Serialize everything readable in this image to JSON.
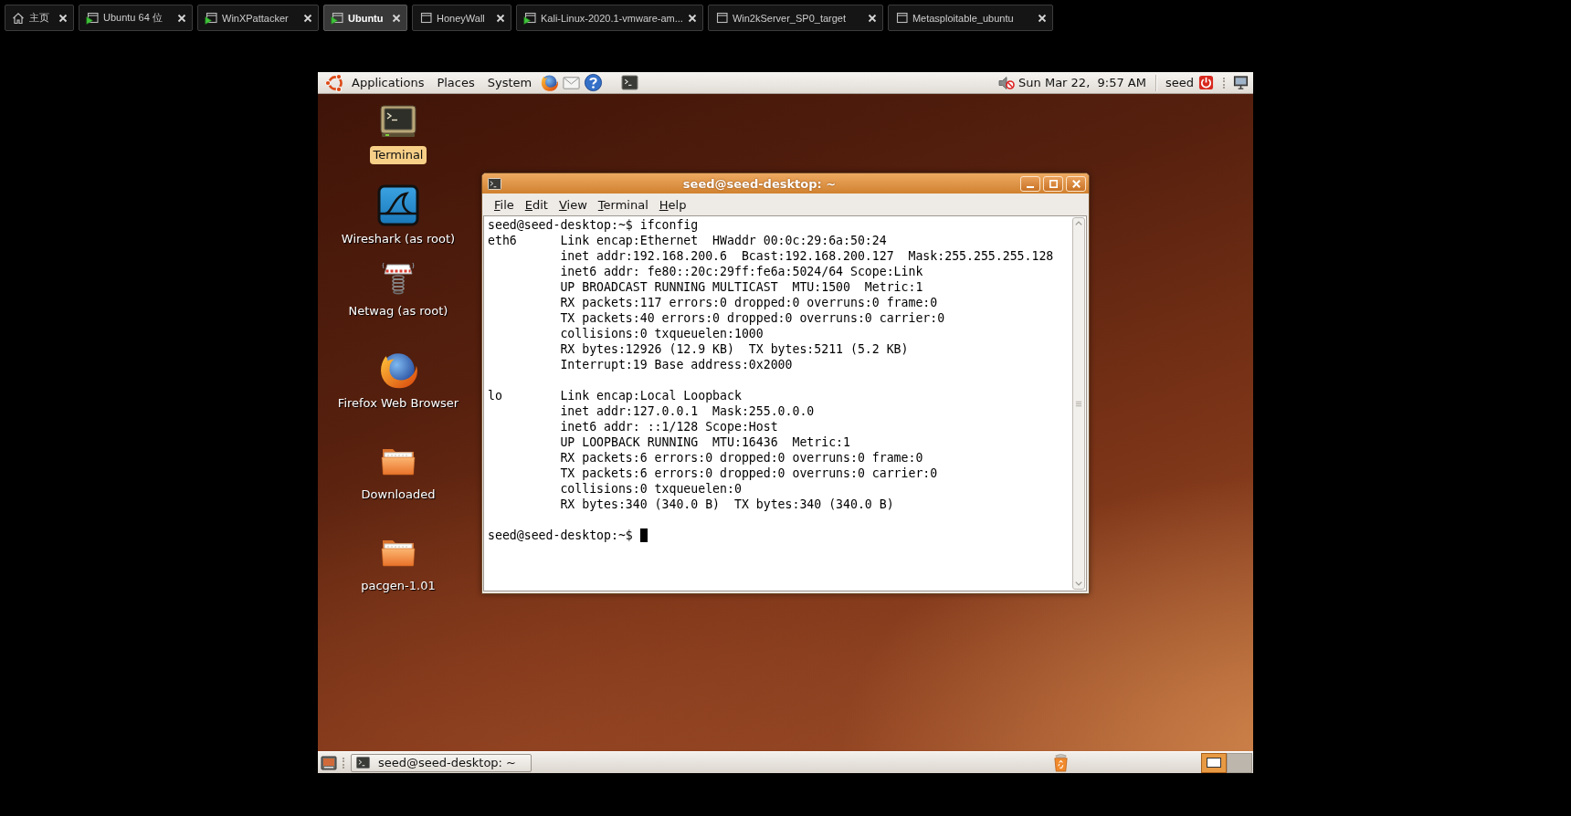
{
  "tabs": [
    {
      "label": "主页",
      "kind": "home",
      "selected": false
    },
    {
      "label": "Ubuntu 64 位",
      "kind": "vm",
      "running": true,
      "selected": false
    },
    {
      "label": "WinXPattacker",
      "kind": "vm",
      "running": true,
      "selected": false
    },
    {
      "label": "Ubuntu",
      "kind": "vm",
      "running": true,
      "selected": true
    },
    {
      "label": "HoneyWall",
      "kind": "vm",
      "running": false,
      "selected": false
    },
    {
      "label": "Kali-Linux-2020.1-vmware-am...",
      "kind": "vm",
      "running": true,
      "selected": false
    },
    {
      "label": "Win2kServer_SP0_target",
      "kind": "vm",
      "running": false,
      "selected": false
    },
    {
      "label": "Metasploitable_ubuntu",
      "kind": "vm",
      "running": false,
      "selected": false
    }
  ],
  "top_panel": {
    "menus": [
      "Applications",
      "Places",
      "System"
    ],
    "clock": "Sun Mar 22,  9:57 AM",
    "user": "seed"
  },
  "desktop_icons": [
    {
      "label": "Terminal",
      "kind": "terminal",
      "selected": true
    },
    {
      "label": "Wireshark (as root)",
      "kind": "wireshark",
      "selected": false
    },
    {
      "label": "Netwag (as root)",
      "kind": "netwag",
      "selected": false
    },
    {
      "label": "Firefox Web Browser",
      "kind": "browser",
      "selected": false
    },
    {
      "label": "Downloaded",
      "kind": "folder",
      "selected": false
    },
    {
      "label": "pacgen-1.01",
      "kind": "folder",
      "selected": false
    }
  ],
  "terminal_window": {
    "title": "seed@seed-desktop: ~",
    "menus": [
      "File",
      "Edit",
      "View",
      "Terminal",
      "Help"
    ],
    "command_line": "seed@seed-desktop:~$ ifconfig",
    "interfaces": [
      {
        "name": "eth6",
        "lines": [
          "Link encap:Ethernet  HWaddr 00:0c:29:6a:50:24",
          "inet addr:192.168.200.6  Bcast:192.168.200.127  Mask:255.255.255.128",
          "inet6 addr: fe80::20c:29ff:fe6a:5024/64 Scope:Link",
          "UP BROADCAST RUNNING MULTICAST  MTU:1500  Metric:1",
          "RX packets:117 errors:0 dropped:0 overruns:0 frame:0",
          "TX packets:40 errors:0 dropped:0 overruns:0 carrier:0",
          "collisions:0 txqueuelen:1000",
          "RX bytes:12926 (12.9 KB)  TX bytes:5211 (5.2 KB)",
          "Interrupt:19 Base address:0x2000"
        ]
      },
      {
        "name": "lo",
        "lines": [
          "Link encap:Local Loopback",
          "inet addr:127.0.0.1  Mask:255.0.0.0",
          "inet6 addr: ::1/128 Scope:Host",
          "UP LOOPBACK RUNNING  MTU:16436  Metric:1",
          "RX packets:6 errors:0 dropped:0 overruns:0 frame:0",
          "TX packets:6 errors:0 dropped:0 overruns:0 carrier:0",
          "collisions:0 txqueuelen:0",
          "RX bytes:340 (340.0 B)  TX bytes:340 (340.0 B)"
        ]
      }
    ],
    "prompt": "seed@seed-desktop:~$"
  },
  "bottom_panel": {
    "tasks": [
      {
        "label": "seed@seed-desktop: ~",
        "selected": false
      }
    ],
    "workspaces": [
      {
        "selected": true,
        "has_window": true
      },
      {
        "selected": false,
        "has_window": false
      }
    ]
  }
}
